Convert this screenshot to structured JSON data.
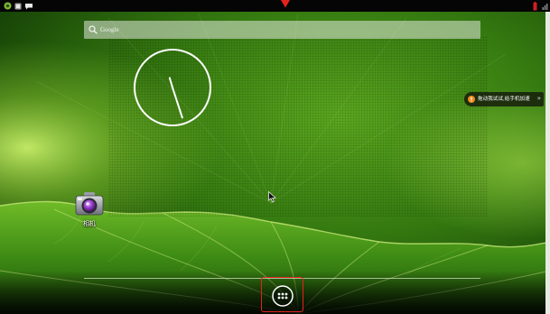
{
  "status_bar": {
    "left_icons": [
      "app-notification-icon",
      "gallery-icon",
      "message-icon"
    ],
    "right_icons": [
      "battery-icon",
      "signal-icon"
    ]
  },
  "search": {
    "label": "Google",
    "icon": "search-icon"
  },
  "clock": {
    "hour": 11,
    "minute": 27
  },
  "notification": {
    "text": "拖动我试试,给手机加速",
    "arrow": "»",
    "icon": "alert-icon"
  },
  "desktop_apps": [
    {
      "label": "相机",
      "icon": "camera-icon"
    }
  ],
  "dock": {
    "app_drawer_icon": "app-drawer-icon"
  },
  "colors": {
    "status_bar": "#050505",
    "wallpaper_green": "#3f8a16",
    "notification_dot": "#f08a1e",
    "highlight": "#e3231c",
    "battery": "#d02020"
  }
}
